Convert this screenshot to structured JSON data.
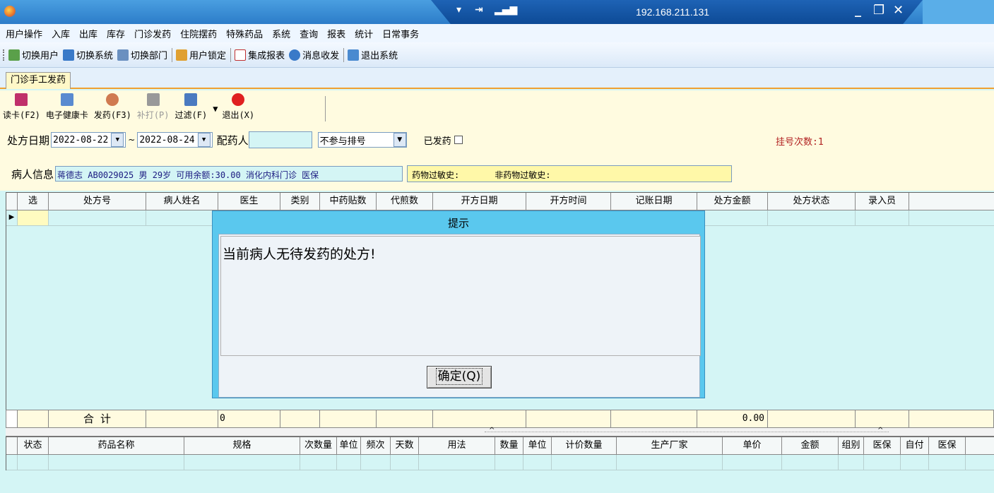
{
  "titlebar": {
    "ip": "192.168.211.131"
  },
  "menu": [
    "用户操作",
    "入库",
    "出库",
    "库存",
    "门诊发药",
    "住院摆药",
    "特殊药品",
    "系统",
    "查询",
    "报表",
    "统计",
    "日常事务"
  ],
  "toolbar": {
    "switch_user": "切换用户",
    "switch_system": "切换系统",
    "switch_dept": "切换部门",
    "lock_user": "用户锁定",
    "integrated_report": "集成报表",
    "messages": "消息收发",
    "exit_system": "退出系统"
  },
  "tab": {
    "label": "门诊手工发药"
  },
  "actions": {
    "read_card": "读卡(F2)",
    "health_card": "电子健康卡",
    "dispense": "发药(F3)",
    "reprint": "补打(P)",
    "filter": "过滤(F)",
    "exit": "退出(X)"
  },
  "filters": {
    "date_label": "处方日期",
    "date_from": "2022-08-22",
    "tilde": "~",
    "date_to": "2022-08-24",
    "dispenser_label": "配药人",
    "queue_option": "不参与排号",
    "dispensed_label": "已发药",
    "registration_count": "挂号次数:1"
  },
  "patient": {
    "label": "病人信息",
    "info": "蒋德志 AB0029025 男 29岁 可用余额:30.00 消化内科门诊 医保",
    "drug_allergy_label": "药物过敏史:",
    "non_drug_allergy_label": "非药物过敏史:"
  },
  "grid1": {
    "columns": [
      "选",
      "处方号",
      "病人姓名",
      "医生",
      "类别",
      "中药贴数",
      "代煎数",
      "开方日期",
      "开方时间",
      "记账日期",
      "处方金额",
      "处方状态",
      "录入员"
    ],
    "total_label": "合  计",
    "total_count": "0",
    "total_amount": "0.00"
  },
  "grid2": {
    "columns": [
      "状态",
      "药品名称",
      "规格",
      "次数量",
      "单位",
      "频次",
      "天数",
      "用法",
      "数量",
      "单位",
      "计价数量",
      "生产厂家",
      "单价",
      "金额",
      "组别",
      "医保",
      "自付",
      "医保"
    ]
  },
  "dialog": {
    "title": "提示",
    "message": "当前病人无待发药的处方!",
    "ok_label": "确定(Q)"
  },
  "colors": {
    "accent": "#2c7cc9",
    "grid_bg": "#d4f5f5",
    "panel_bg": "#fffbe0",
    "dialog_bg": "#5ac8ee"
  }
}
